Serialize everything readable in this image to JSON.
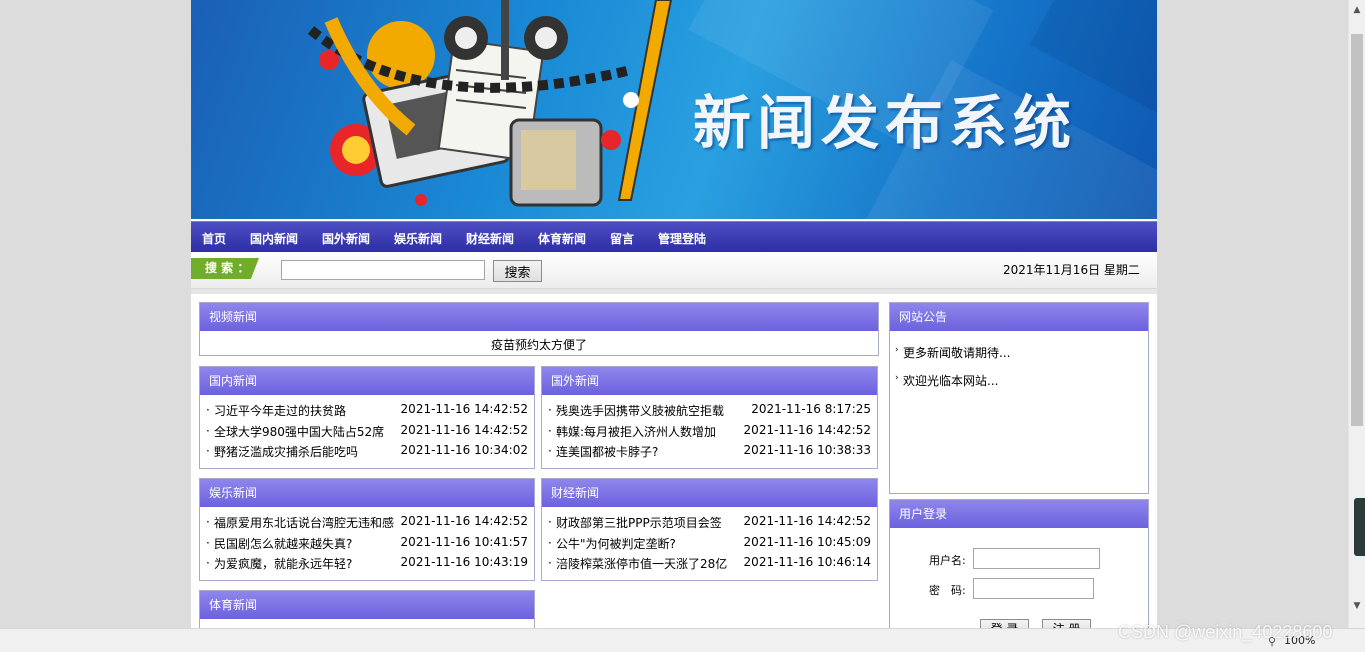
{
  "banner": {
    "title": "新闻发布系统"
  },
  "nav": {
    "items": [
      "首页",
      "国内新闻",
      "国外新闻",
      "娱乐新闻",
      "财经新闻",
      "体育新闻",
      "留言",
      "管理登陆"
    ]
  },
  "search": {
    "tag": "搜 索 ：",
    "button": "搜索",
    "value": ""
  },
  "date": "2021年11月16日 星期二",
  "video": {
    "title": "视频新闻",
    "item": "疫苗预约太方便了"
  },
  "domestic": {
    "title": "国内新闻",
    "items": [
      {
        "t": "习近平今年走过的扶贫路",
        "d": "2021-11-16 14:42:52"
      },
      {
        "t": "全球大学980强中国大陆占52席",
        "d": "2021-11-16 14:42:52"
      },
      {
        "t": "野猪泛滥成灾捕杀后能吃吗",
        "d": "2021-11-16 10:34:02"
      }
    ]
  },
  "foreign": {
    "title": "国外新闻",
    "items": [
      {
        "t": "残奥选手因携带义肢被航空拒载",
        "d": "2021-11-16 8:17:25"
      },
      {
        "t": "韩媒:每月被拒入济州人数增加",
        "d": "2021-11-16 14:42:52"
      },
      {
        "t": "连美国都被卡脖子?",
        "d": "2021-11-16 10:38:33"
      }
    ]
  },
  "ent": {
    "title": "娱乐新闻",
    "items": [
      {
        "t": "福原爱用东北话说台湾腔无违和感",
        "d": "2021-11-16 14:42:52"
      },
      {
        "t": "民国剧怎么就越来越失真?",
        "d": "2021-11-16 10:41:57"
      },
      {
        "t": "为爱疯魔，就能永远年轻?",
        "d": "2021-11-16 10:43:19"
      }
    ]
  },
  "finance": {
    "title": "财经新闻",
    "items": [
      {
        "t": "财政部第三批PPP示范项目会签",
        "d": "2021-11-16 14:42:52"
      },
      {
        "t": "公牛\"为何被判定垄断?",
        "d": "2021-11-16 10:45:09"
      },
      {
        "t": "涪陵榨菜涨停市值一天涨了28亿",
        "d": "2021-11-16 10:46:14"
      }
    ]
  },
  "sports": {
    "title": "体育新闻"
  },
  "notice": {
    "title": "网站公告",
    "items": [
      "更多新闻敬请期待...",
      "欢迎光临本网站..."
    ]
  },
  "login": {
    "title": "用户登录",
    "user_label": "用户名:",
    "pass_label": "密　码:",
    "login_btn": "登 录",
    "register_btn": "注 册"
  },
  "status": {
    "zoom": "100%"
  },
  "watermark": "CSDN @weixin_40228600"
}
